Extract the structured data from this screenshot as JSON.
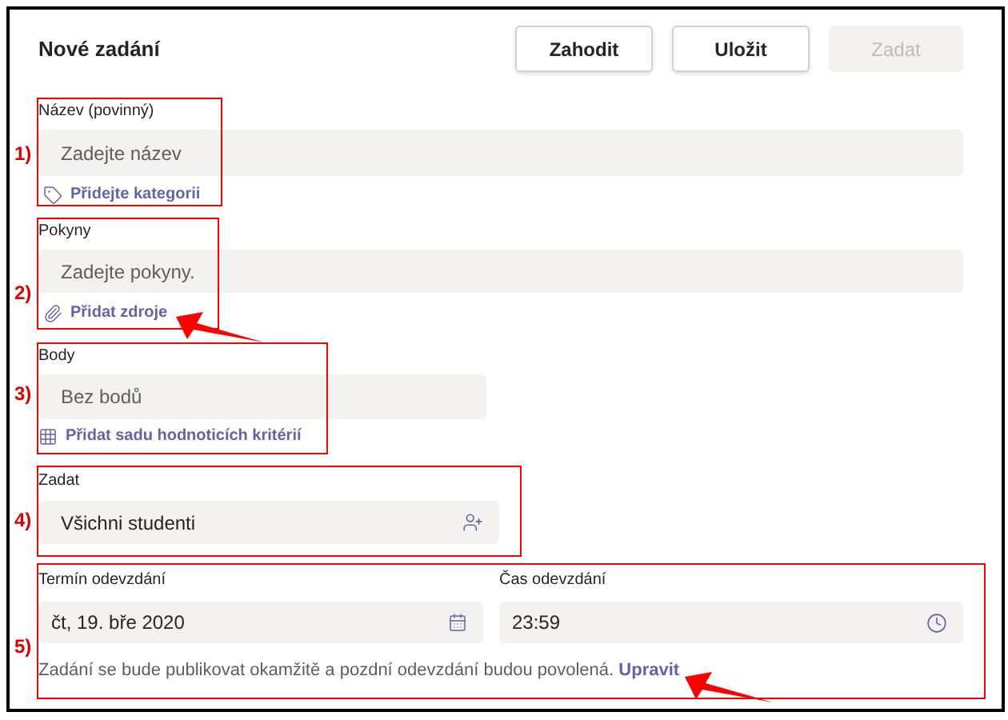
{
  "title": "Nové zadání",
  "buttons": [
    {
      "label": "Zahodit",
      "disabled": false
    },
    {
      "label": "Uložit",
      "disabled": false
    },
    {
      "label": "Zadat",
      "disabled": true
    }
  ],
  "name": {
    "marker": "1)",
    "label": "Název (povinný)",
    "placeholder": "Zadejte název",
    "link": "Přidejte kategorii"
  },
  "instructions": {
    "marker": "2)",
    "label": "Pokyny",
    "placeholder": "Zadejte pokyny.",
    "link": "Přidat zdroje"
  },
  "points": {
    "marker": "3)",
    "label": "Body",
    "placeholder": "Bez bodů",
    "link": "Přidat sadu hodnoticích kritérií"
  },
  "assign": {
    "marker": "4)",
    "label": "Zadat",
    "value": "Všichni studenti"
  },
  "due": {
    "marker": "5)",
    "date_label": "Termín odevzdání",
    "date": "čt, 19. bře 2020",
    "time_label": "Čas odevzdání",
    "time": "23:59",
    "note": "Zadání se bude publikovat okamžitě a pozdní odevzdání budou povolená.",
    "note_link": "Upravit"
  }
}
